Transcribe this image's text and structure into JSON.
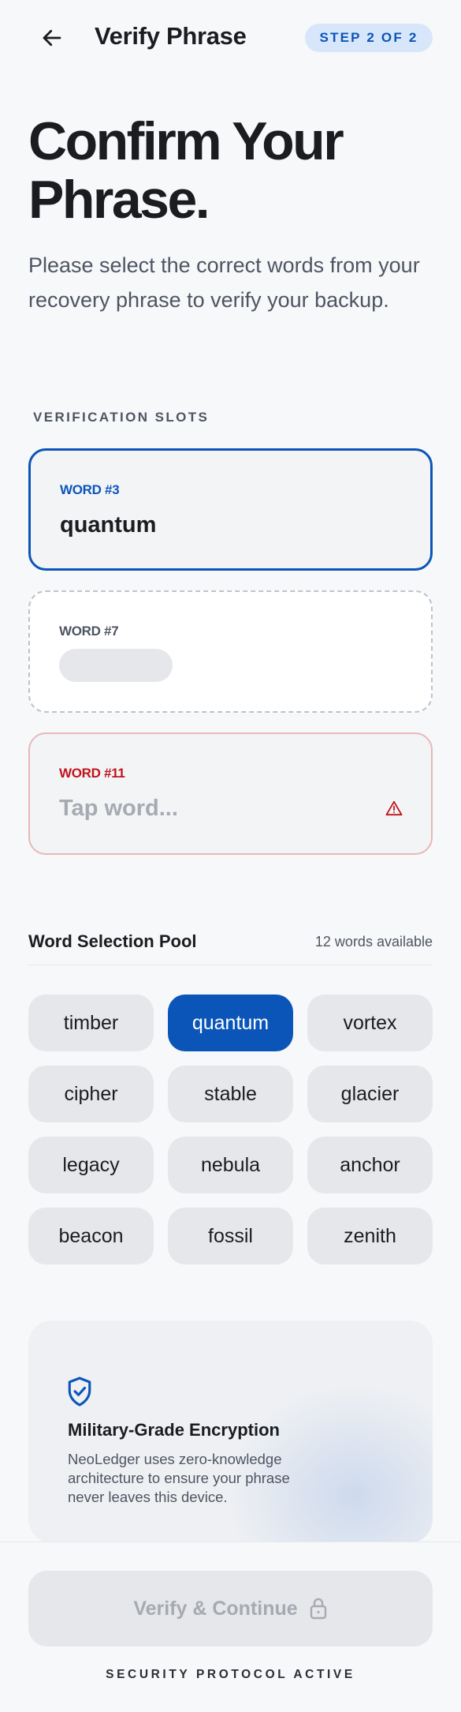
{
  "header": {
    "title": "Verify Phrase",
    "step_badge": "STEP 2 OF 2",
    "back_icon": "arrow-left-icon"
  },
  "hero": {
    "title_line1": "Confirm Your",
    "title_line2": "Phrase.",
    "subtitle": "Please select the correct words from your recovery phrase to verify your backup."
  },
  "slots": {
    "section_label": "VERIFICATION SLOTS",
    "items": [
      {
        "label": "WORD #3",
        "value": "quantum",
        "state": "filled"
      },
      {
        "label": "WORD #7",
        "value": "",
        "state": "empty"
      },
      {
        "label": "WORD #11",
        "value": "Tap word...",
        "state": "error"
      }
    ]
  },
  "pool": {
    "title": "Word Selection Pool",
    "count_text": "12 words available",
    "words": [
      "timber",
      "quantum",
      "vortex",
      "cipher",
      "stable",
      "glacier",
      "legacy",
      "nebula",
      "anchor",
      "beacon",
      "fossil",
      "zenith"
    ],
    "selected": "quantum"
  },
  "info": {
    "icon": "shield-check-icon",
    "title": "Military-Grade Encryption",
    "text": "NeoLedger uses zero-knowledge architecture to ensure your phrase never leaves this device."
  },
  "footer": {
    "cta_label": "Verify & Continue",
    "cta_icon": "lock-icon",
    "status": "SECURITY PROTOCOL ACTIVE"
  },
  "colors": {
    "accent": "#0b55b8",
    "accent_soft": "#d8e6fb",
    "error": "#c0141c",
    "background": "#f7f8fa",
    "chip": "#e6e7ea"
  }
}
